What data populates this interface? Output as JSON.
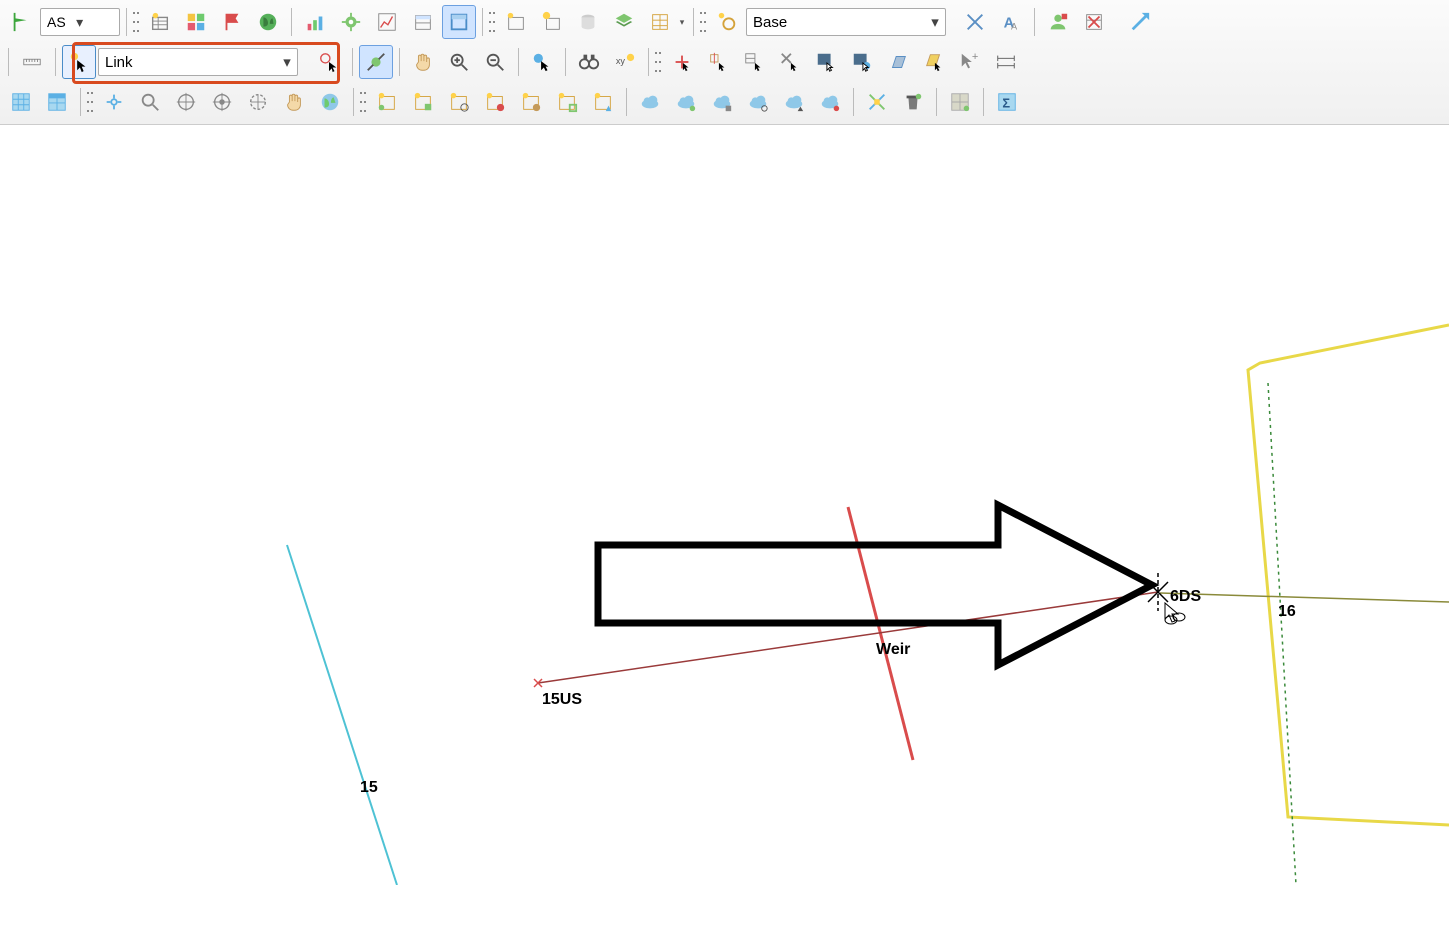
{
  "toolbar": {
    "combo1": "AS",
    "link_tool": "Link",
    "combo_base": "Base"
  },
  "canvas": {
    "labels": {
      "n15": "15",
      "n15us": "15US",
      "weir": "Weir",
      "n6ds": "6DS",
      "n16": "16"
    }
  }
}
